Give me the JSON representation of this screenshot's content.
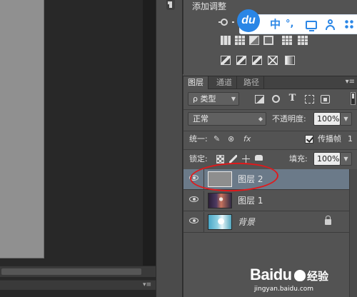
{
  "adjustments": {
    "title": "添加调整"
  },
  "ime": {
    "logo": "du",
    "lang": "中",
    "punct": "°,"
  },
  "layers_panel": {
    "tabs": [
      {
        "label": "图层",
        "active": true
      },
      {
        "label": "通道",
        "active": false
      },
      {
        "label": "路径",
        "active": false
      }
    ],
    "filter_label": "ρ 类型",
    "blend_mode": "正常",
    "opacity_label": "不透明度:",
    "opacity_value": "100%",
    "unify_label": "统一:",
    "propagate_label": "传播帧",
    "propagate_value": "1",
    "propagate_checked": true,
    "lock_label": "锁定:",
    "fill_label": "填充:",
    "fill_value": "100%",
    "layers": [
      {
        "name": "图层 2",
        "selected": true,
        "visible": true,
        "thumb": "gray"
      },
      {
        "name": "图层 1",
        "selected": false,
        "visible": true,
        "thumb": "photo"
      },
      {
        "name": "背景",
        "selected": false,
        "visible": true,
        "thumb": "background",
        "locked": true,
        "italic": true
      }
    ]
  },
  "watermark": {
    "brand": "Baidu",
    "experience": "经验",
    "url": "jingyan.baidu.com"
  },
  "colors": {
    "panel_bg": "#535353",
    "selected_layer": "#6b7a89",
    "annotation_red": "#e0191b",
    "ime_blue": "#2a86e6"
  }
}
